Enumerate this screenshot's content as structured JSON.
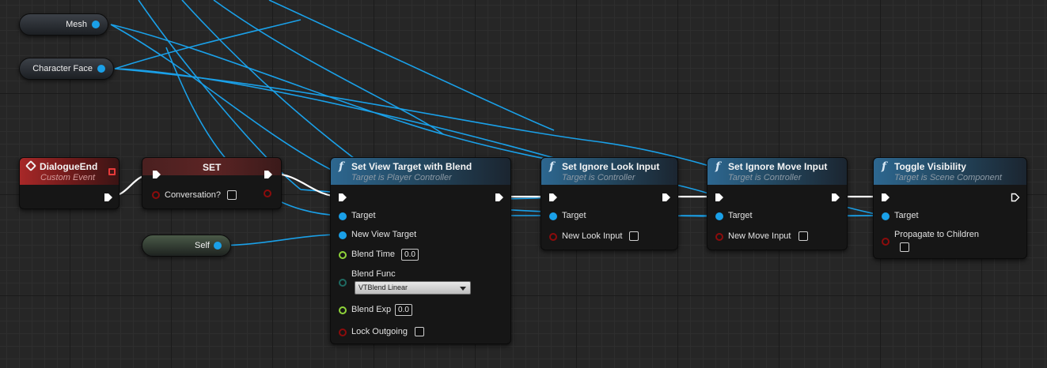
{
  "variables": {
    "mesh": "Mesh",
    "character_face": "Character Face",
    "self": "Self"
  },
  "event_node": {
    "title": "DialogueEnd",
    "subtitle": "Custom Event"
  },
  "set_node": {
    "title": "SET",
    "pin_conversation": "Conversation?"
  },
  "view_target_node": {
    "icon": "f",
    "title": "Set View Target with Blend",
    "subtitle": "Target is Player Controller",
    "pin_target": "Target",
    "pin_new_view_target": "New View Target",
    "pin_blend_time": "Blend Time",
    "blend_time_value": "0.0",
    "pin_blend_func": "Blend Func",
    "blend_func_value": "VTBlend Linear",
    "pin_blend_exp": "Blend Exp",
    "blend_exp_value": "0.0",
    "pin_lock_outgoing": "Lock Outgoing"
  },
  "look_input_node": {
    "icon": "f",
    "title": "Set Ignore Look Input",
    "subtitle": "Target is Controller",
    "pin_target": "Target",
    "pin_new_look_input": "New Look Input"
  },
  "move_input_node": {
    "icon": "f",
    "title": "Set Ignore Move Input",
    "subtitle": "Target is Controller",
    "pin_target": "Target",
    "pin_new_move_input": "New Move Input"
  },
  "toggle_node": {
    "icon": "f",
    "title": "Toggle Visibility",
    "subtitle": "Target is Scene Component",
    "pin_target": "Target",
    "pin_propagate": "Propagate to Children"
  },
  "colors": {
    "exec_wire": "#ffffff",
    "object_wire": "#1aa0e8",
    "bool_pin": "#8c0c0c",
    "float_pin": "#8fd43a",
    "function_header": "#2d6790",
    "event_header": "#a82828"
  }
}
